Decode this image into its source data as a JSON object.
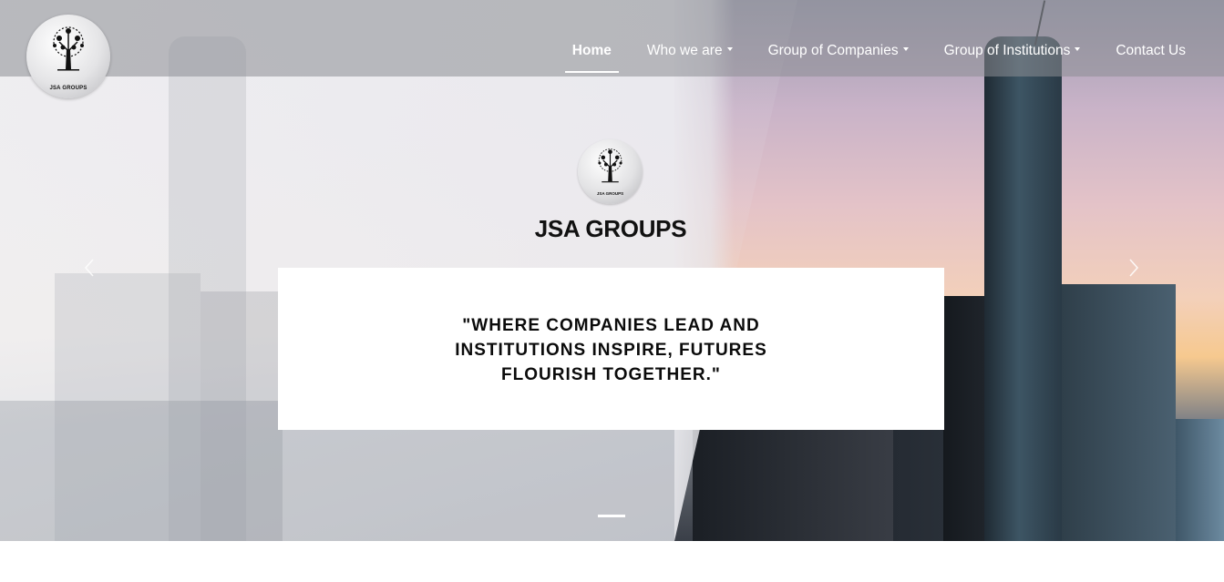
{
  "brand": {
    "logo_caption": "JSA GROUPS",
    "title": "JSA GROUPS"
  },
  "nav": {
    "items": [
      {
        "label": "Home",
        "active": true,
        "dropdown": false
      },
      {
        "label": "Who we are",
        "active": false,
        "dropdown": true
      },
      {
        "label": "Group of Companies",
        "active": false,
        "dropdown": true
      },
      {
        "label": "Group of Institutions",
        "active": false,
        "dropdown": true
      },
      {
        "label": "Contact Us",
        "active": false,
        "dropdown": false
      }
    ]
  },
  "hero": {
    "quote": "\"WHERE COMPANIES LEAD AND INSTITUTIONS INSPIRE, FUTURES FLOURISH TOGETHER.\"",
    "carousel": {
      "prev_icon": "chevron-left-icon",
      "next_icon": "chevron-right-icon",
      "active_slide": 1,
      "slide_count": 1
    }
  },
  "colors": {
    "nav_text": "#ffffff",
    "title_text": "#111111",
    "quote_box": "#ffffff"
  }
}
